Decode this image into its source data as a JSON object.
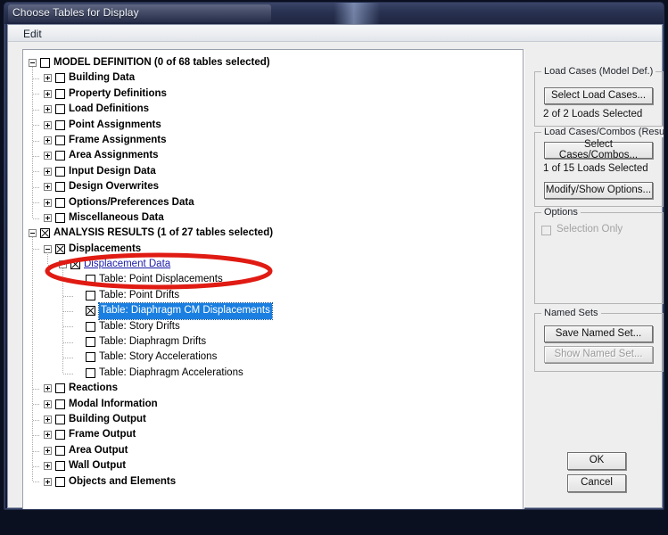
{
  "window": {
    "title": "Choose Tables for Display",
    "menu": [
      {
        "label": "Edit"
      }
    ]
  },
  "tree": {
    "nodes": [
      {
        "label": "MODEL DEFINITION  (0 of 68 tables selected)",
        "depth": 0,
        "expander": "minus",
        "checked": false,
        "style": "bold"
      },
      {
        "label": "Building Data",
        "depth": 1,
        "expander": "plus",
        "checked": false,
        "style": "bold"
      },
      {
        "label": "Property Definitions",
        "depth": 1,
        "expander": "plus",
        "checked": false,
        "style": "bold"
      },
      {
        "label": "Load Definitions",
        "depth": 1,
        "expander": "plus",
        "checked": false,
        "style": "bold"
      },
      {
        "label": "Point Assignments",
        "depth": 1,
        "expander": "plus",
        "checked": false,
        "style": "bold"
      },
      {
        "label": "Frame Assignments",
        "depth": 1,
        "expander": "plus",
        "checked": false,
        "style": "bold"
      },
      {
        "label": "Area Assignments",
        "depth": 1,
        "expander": "plus",
        "checked": false,
        "style": "bold"
      },
      {
        "label": "Input Design Data",
        "depth": 1,
        "expander": "plus",
        "checked": false,
        "style": "bold"
      },
      {
        "label": "Design Overwrites",
        "depth": 1,
        "expander": "plus",
        "checked": false,
        "style": "bold"
      },
      {
        "label": "Options/Preferences Data",
        "depth": 1,
        "expander": "plus",
        "checked": false,
        "style": "bold"
      },
      {
        "label": "Miscellaneous Data",
        "depth": 1,
        "expander": "plus",
        "checked": false,
        "style": "bold"
      },
      {
        "label": "ANALYSIS RESULTS  (1 of 27 tables selected)",
        "depth": 0,
        "expander": "minus",
        "checked": true,
        "style": "bold"
      },
      {
        "label": "Displacements",
        "depth": 1,
        "expander": "minus",
        "checked": true,
        "style": "bold"
      },
      {
        "label": "Displacement Data",
        "depth": 2,
        "expander": "minus",
        "checked": true,
        "style": "link"
      },
      {
        "label": "Table:  Point Displacements",
        "depth": 3,
        "expander": "none",
        "checked": false,
        "style": "normal"
      },
      {
        "label": "Table:  Point Drifts",
        "depth": 3,
        "expander": "none",
        "checked": false,
        "style": "normal"
      },
      {
        "label": "Table:  Diaphragm CM Displacements",
        "depth": 3,
        "expander": "none",
        "checked": true,
        "style": "selected"
      },
      {
        "label": "Table:  Story Drifts",
        "depth": 3,
        "expander": "none",
        "checked": false,
        "style": "normal"
      },
      {
        "label": "Table:  Diaphragm Drifts",
        "depth": 3,
        "expander": "none",
        "checked": false,
        "style": "normal"
      },
      {
        "label": "Table:  Story Accelerations",
        "depth": 3,
        "expander": "none",
        "checked": false,
        "style": "normal"
      },
      {
        "label": "Table:  Diaphragm Accelerations",
        "depth": 3,
        "expander": "none",
        "checked": false,
        "style": "normal"
      },
      {
        "label": "Reactions",
        "depth": 1,
        "expander": "plus",
        "checked": false,
        "style": "bold"
      },
      {
        "label": "Modal Information",
        "depth": 1,
        "expander": "plus",
        "checked": false,
        "style": "bold"
      },
      {
        "label": "Building Output",
        "depth": 1,
        "expander": "plus",
        "checked": false,
        "style": "bold"
      },
      {
        "label": "Frame Output",
        "depth": 1,
        "expander": "plus",
        "checked": false,
        "style": "bold"
      },
      {
        "label": "Area Output",
        "depth": 1,
        "expander": "plus",
        "checked": false,
        "style": "bold"
      },
      {
        "label": "Wall Output",
        "depth": 1,
        "expander": "plus",
        "checked": false,
        "style": "bold"
      },
      {
        "label": "Objects and Elements",
        "depth": 1,
        "expander": "plus",
        "checked": false,
        "style": "bold"
      }
    ]
  },
  "panels": {
    "load_cases_model_def": {
      "legend": "Load Cases (Model Def.)",
      "select_button": "Select Load Cases...",
      "status": "2  of  2  Loads Selected"
    },
    "load_cases_results": {
      "legend": "Load Cases/Combos (Results)",
      "select_button": "Select Cases/Combos...",
      "status": "1  of  15  Loads Selected",
      "modify_button": "Modify/Show Options..."
    },
    "options": {
      "legend": "Options",
      "selection_only_label": "Selection Only",
      "selection_only_checked": false,
      "selection_only_enabled": false
    },
    "named_sets": {
      "legend": "Named Sets",
      "save_button": "Save Named Set...",
      "show_button": "Show Named Set...",
      "show_enabled": false
    }
  },
  "footer": {
    "ok_button": "OK",
    "cancel_button": "Cancel"
  },
  "annotation": {
    "shape": "ellipse",
    "color": "#e01b13",
    "targets": "Table:  Diaphragm CM Displacements"
  },
  "colors": {
    "title_bar": "#2a3352",
    "dialog_bg": "#eeeeee",
    "tree_bg": "#ffffff",
    "selection_blue": "#1a7fe0",
    "link_text": "#1a1aa8",
    "annotation_red": "#e01b13"
  }
}
